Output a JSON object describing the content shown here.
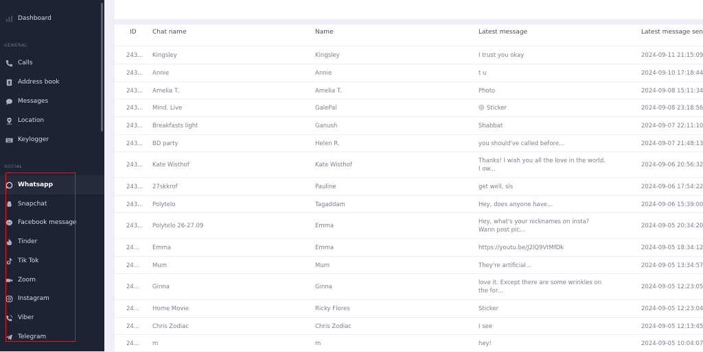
{
  "sidebar": {
    "dashboard_label": "Dashboard",
    "sections": {
      "general": "GENERAL",
      "social": "SOCIAL"
    },
    "general_items": [
      {
        "label": "Calls",
        "icon": "phone-icon"
      },
      {
        "label": "Address book",
        "icon": "address-book-icon"
      },
      {
        "label": "Messages",
        "icon": "chat-bubble-icon"
      },
      {
        "label": "Location",
        "icon": "location-pin-icon"
      },
      {
        "label": "Keylogger",
        "icon": "keyboard-icon"
      }
    ],
    "social_items": [
      {
        "label": "Whatsapp",
        "icon": "whatsapp-icon",
        "active": true
      },
      {
        "label": "Snapchat",
        "icon": "snapchat-icon"
      },
      {
        "label": "Facebook message",
        "icon": "messenger-icon"
      },
      {
        "label": "Tinder",
        "icon": "tinder-icon"
      },
      {
        "label": "Tik Tok",
        "icon": "tiktok-icon"
      },
      {
        "label": "Zoom",
        "icon": "video-camera-icon"
      },
      {
        "label": "Instagram",
        "icon": "instagram-icon"
      },
      {
        "label": "Viber",
        "icon": "viber-icon"
      },
      {
        "label": "Telegram",
        "icon": "telegram-icon"
      }
    ]
  },
  "table": {
    "headers": {
      "id": "ID",
      "chat_name": "Chat name",
      "name": "Name",
      "latest_message": "Latest message",
      "latest_sent": "Latest message sent"
    },
    "rows": [
      {
        "id": "243...",
        "chat_name": "Kingsley",
        "name": "Kingsley",
        "message": "I trust you okay",
        "sent": "2024-09-11 21:15:09"
      },
      {
        "id": "243...",
        "chat_name": "Annie",
        "name": "Annie",
        "message": "t u",
        "sent": "2024-09-10 17:18:44"
      },
      {
        "id": "243...",
        "chat_name": "Amelia T.",
        "name": "Amelia T.",
        "message": "Photo",
        "sent": "2024-09-08 15:11:34"
      },
      {
        "id": "243...",
        "chat_name": "Mind. Live",
        "name": "GalePal",
        "message": "Sticker",
        "emoji": "😜",
        "sent": "2024-09-08 23:18:56"
      },
      {
        "id": "243...",
        "chat_name": "Breakfasts light",
        "name": "Ganush",
        "message": "Shabbat",
        "sent": "2024-09-07 22:11:10"
      },
      {
        "id": "243...",
        "chat_name": "BD party",
        "name": "Helen R.",
        "message": "you should've called before...",
        "sent": "2024-09-07 21:48:13"
      },
      {
        "id": "243...",
        "chat_name": "Kate Wisthof",
        "name": "Kate Wisthof",
        "message": "Thanks! I wish you all the love in the world. I ow...",
        "sent": "2024-09-06 20:56:32"
      },
      {
        "id": "243...",
        "chat_name": "27skkrof",
        "name": "Pauline",
        "message": "get well, sis",
        "sent": "2024-09-06 17:54:22"
      },
      {
        "id": "243...",
        "chat_name": "Polytelo",
        "name": "Tagaddam",
        "message": "Hey, does anyone have...",
        "sent": "2024-09-06 15:39:00"
      },
      {
        "id": "243...",
        "chat_name": "Polytelo 26-27.09",
        "name": "Emma",
        "message": "Hey, what's your nicknames on insta? Wann post pic...",
        "sent": "2024-09-05 20:34:20"
      },
      {
        "id": "24...",
        "chat_name": "Emma",
        "name": "Emma",
        "message": "https://youtu.be/J2lQ9VtMfDk",
        "sent": "2024-09-05 18:34:12"
      },
      {
        "id": "24...",
        "chat_name": "Mum",
        "name": "Mum",
        "message": "They're artificial...",
        "sent": "2024-09-05 13:34:57"
      },
      {
        "id": "24...",
        "chat_name": "Ginna",
        "name": "Ginna",
        "message": "love it. Except there are some wrinkles on the for...",
        "sent": "2024-09-05 12:23:05"
      },
      {
        "id": "24...",
        "chat_name": "Home Movie",
        "name": "Ricky Flores",
        "message": "Sticker",
        "sent": "2024-09-05 12:23:04"
      },
      {
        "id": "24...",
        "chat_name": "Chris Zodiac",
        "name": "Chris Zodiac",
        "message": "I see",
        "sent": "2024-09-05 12:13:45"
      },
      {
        "id": "24...",
        "chat_name": "m",
        "name": "m",
        "message": "hey!",
        "sent": "2024-09-05 10:04:07"
      }
    ]
  },
  "colors": {
    "sidebar_bg": "#1e2334",
    "highlight": "#e0191f",
    "page_bg": "#eef0f5"
  }
}
